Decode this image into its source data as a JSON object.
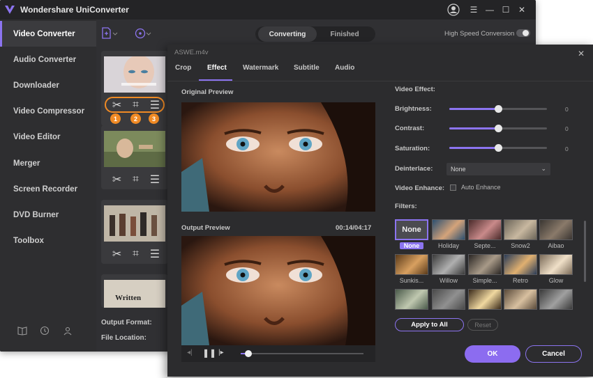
{
  "app": {
    "title": "Wondershare UniConverter",
    "accent_color": "#8c74f0",
    "highlight_color": "#f08a24"
  },
  "sidebar": {
    "items": [
      {
        "label": "Video Converter",
        "active": true
      },
      {
        "label": "Audio Converter"
      },
      {
        "label": "Downloader"
      },
      {
        "label": "Video Compressor"
      },
      {
        "label": "Video Editor"
      },
      {
        "label": "Merger"
      },
      {
        "label": "Screen Recorder"
      },
      {
        "label": "DVD Burner"
      },
      {
        "label": "Toolbox"
      }
    ],
    "footer_icons": [
      "book-icon",
      "clock-icon",
      "user-icon"
    ]
  },
  "toolbar": {
    "tabs": [
      {
        "label": "Converting",
        "active": true
      },
      {
        "label": "Finished"
      }
    ],
    "high_speed_label": "High Speed Conversion",
    "high_speed_on": false
  },
  "file_list": {
    "tool_badges": [
      "1",
      "2",
      "3"
    ],
    "card4_text": "Written",
    "output_format_label": "Output Format:",
    "file_location_label": "File Location:"
  },
  "dialog": {
    "title": "ASWE.m4v",
    "tabs": [
      "Crop",
      "Effect",
      "Watermark",
      "Subtitle",
      "Audio"
    ],
    "active_tab": "Effect",
    "original_preview_label": "Original Preview",
    "output_preview_label": "Output Preview",
    "timecode": "00:14/04:17",
    "playback_progress": 0.06,
    "video_effect_label": "Video Effect:",
    "sliders": [
      {
        "label": "Brightness:",
        "value": "0",
        "level": 0.5
      },
      {
        "label": "Contrast:",
        "value": "0",
        "level": 0.5
      },
      {
        "label": "Saturation:",
        "value": "0",
        "level": 0.5
      }
    ],
    "deinterlace_label": "Deinterlace:",
    "deinterlace_value": "None",
    "video_enhance_label": "Video Enhance:",
    "auto_enhance_label": "Auto Enhance",
    "auto_enhance_checked": false,
    "filters_label": "Filters:",
    "filters": [
      {
        "label": "None",
        "selected": true
      },
      {
        "label": "Holiday"
      },
      {
        "label": "Septe..."
      },
      {
        "label": "Snow2"
      },
      {
        "label": "Aibao"
      },
      {
        "label": "Sunkis..."
      },
      {
        "label": "Willow"
      },
      {
        "label": "Simple..."
      },
      {
        "label": "Retro"
      },
      {
        "label": "Glow"
      },
      {
        "label": ""
      },
      {
        "label": ""
      },
      {
        "label": ""
      },
      {
        "label": ""
      },
      {
        "label": ""
      }
    ],
    "none_thumb_text": "None",
    "apply_all_label": "Apply to All",
    "reset_label": "Reset",
    "ok_label": "OK",
    "cancel_label": "Cancel"
  }
}
